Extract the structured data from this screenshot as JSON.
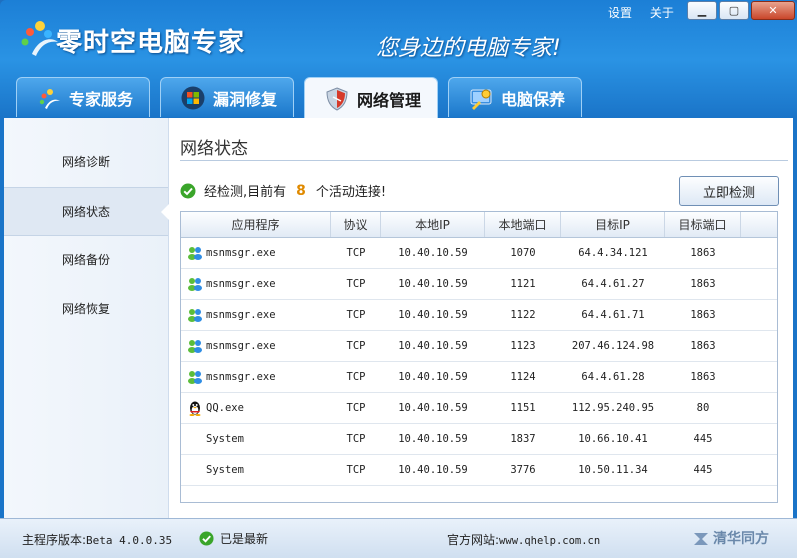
{
  "header": {
    "app_title": "零时空电脑专家",
    "slogan": "您身边的电脑专家!",
    "settings_label": "设置",
    "about_label": "关于"
  },
  "tabs": [
    {
      "label": "专家服务",
      "icon": "expert-service-icon",
      "active": false
    },
    {
      "label": "漏洞修复",
      "icon": "windows-logo-icon",
      "active": false
    },
    {
      "label": "网络管理",
      "icon": "shield-icon",
      "active": true
    },
    {
      "label": "电脑保养",
      "icon": "maintenance-icon",
      "active": false
    }
  ],
  "sidebar": {
    "items": [
      {
        "label": "网络诊断",
        "active": false
      },
      {
        "label": "网络状态",
        "active": true
      },
      {
        "label": "网络备份",
        "active": false
      },
      {
        "label": "网络恢复",
        "active": false
      }
    ]
  },
  "main": {
    "section_title": "网络状态",
    "status_prefix": "经检测,目前有",
    "status_count": "8",
    "status_suffix": "个活动连接!",
    "detect_button": "立即检测"
  },
  "table": {
    "headers": [
      "应用程序",
      "协议",
      "本地IP",
      "本地端口",
      "目标IP",
      "目标端口"
    ],
    "rows": [
      {
        "app": "msnmsgr.exe",
        "icon": "msn-icon",
        "proto": "TCP",
        "local_ip": "10.40.10.59",
        "local_port": "1070",
        "remote_ip": "64.4.34.121",
        "remote_port": "1863"
      },
      {
        "app": "msnmsgr.exe",
        "icon": "msn-icon",
        "proto": "TCP",
        "local_ip": "10.40.10.59",
        "local_port": "1121",
        "remote_ip": "64.4.61.27",
        "remote_port": "1863"
      },
      {
        "app": "msnmsgr.exe",
        "icon": "msn-icon",
        "proto": "TCP",
        "local_ip": "10.40.10.59",
        "local_port": "1122",
        "remote_ip": "64.4.61.71",
        "remote_port": "1863"
      },
      {
        "app": "msnmsgr.exe",
        "icon": "msn-icon",
        "proto": "TCP",
        "local_ip": "10.40.10.59",
        "local_port": "1123",
        "remote_ip": "207.46.124.98",
        "remote_port": "1863"
      },
      {
        "app": "msnmsgr.exe",
        "icon": "msn-icon",
        "proto": "TCP",
        "local_ip": "10.40.10.59",
        "local_port": "1124",
        "remote_ip": "64.4.61.28",
        "remote_port": "1863"
      },
      {
        "app": "QQ.exe",
        "icon": "qq-penguin-icon",
        "proto": "TCP",
        "local_ip": "10.40.10.59",
        "local_port": "1151",
        "remote_ip": "112.95.240.95",
        "remote_port": "80"
      },
      {
        "app": "System",
        "icon": "",
        "proto": "TCP",
        "local_ip": "10.40.10.59",
        "local_port": "1837",
        "remote_ip": "10.66.10.41",
        "remote_port": "445"
      },
      {
        "app": "System",
        "icon": "",
        "proto": "TCP",
        "local_ip": "10.40.10.59",
        "local_port": "3776",
        "remote_ip": "10.50.11.34",
        "remote_port": "445"
      }
    ]
  },
  "footer": {
    "version_label": "主程序版本:",
    "version_value": "Beta 4.0.0.35",
    "update_status": "已是最新",
    "site_label": "官方网站:",
    "site_url": "www.qhelp.com.cn",
    "brand": "清华同方"
  },
  "colors": {
    "title_bar": "#1c7fd6",
    "accent_count": "#e08a00",
    "check_green": "#3aa52a",
    "close_button": "#c9462a"
  }
}
